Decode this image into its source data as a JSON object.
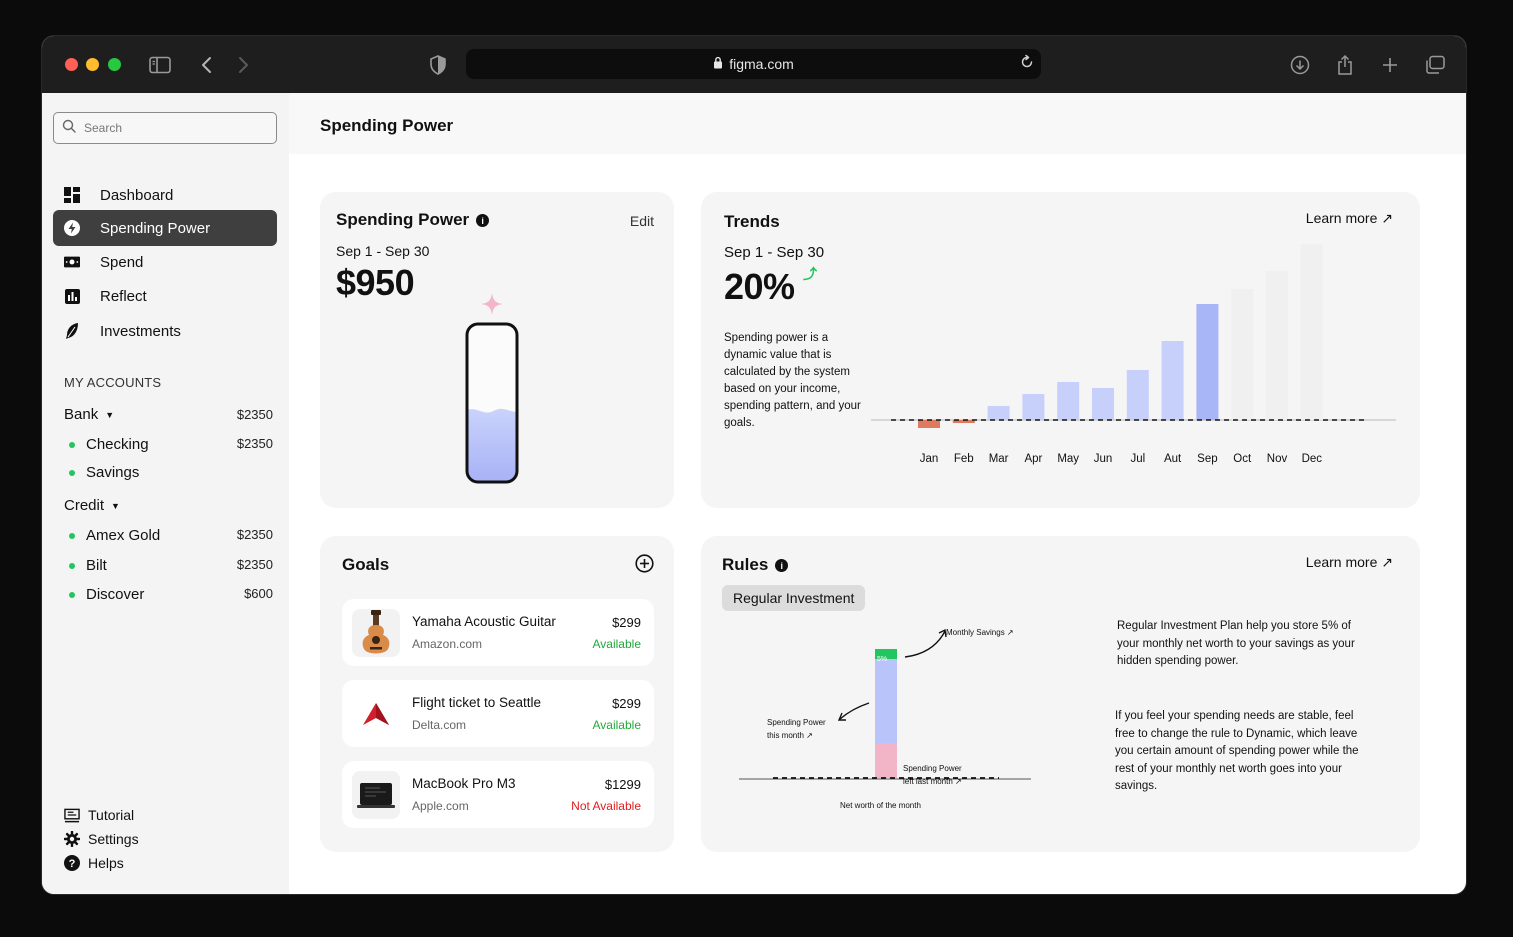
{
  "browser": {
    "url": "figma.com"
  },
  "sidebar": {
    "search_placeholder": "Search",
    "nav": [
      {
        "label": "Dashboard",
        "icon": "grid-icon"
      },
      {
        "label": "Spending Power",
        "icon": "bolt-icon",
        "active": true
      },
      {
        "label": "Spend",
        "icon": "cash-icon"
      },
      {
        "label": "Reflect",
        "icon": "bar-chart-icon"
      },
      {
        "label": "Investments",
        "icon": "feather-icon"
      }
    ],
    "accounts_heading": "MY ACCOUNTS",
    "bank": {
      "label": "Bank",
      "amount": "$2350",
      "accounts": [
        {
          "label": "Checking",
          "amount": "$2350"
        },
        {
          "label": "Savings",
          "amount": ""
        }
      ]
    },
    "credit": {
      "label": "Credit",
      "accounts": [
        {
          "label": "Amex Gold",
          "amount": "$2350"
        },
        {
          "label": "Bilt",
          "amount": "$2350"
        },
        {
          "label": "Discover",
          "amount": "$600"
        }
      ]
    },
    "footer": [
      {
        "label": "Tutorial"
      },
      {
        "label": "Settings"
      },
      {
        "label": "Helps"
      }
    ]
  },
  "header": {
    "title": "Spending Power"
  },
  "spending_power": {
    "title": "Spending Power",
    "edit_label": "Edit",
    "range": "Sep 1 - Sep 30",
    "amount": "$950",
    "fill_level": 0.45
  },
  "trends": {
    "title": "Trends",
    "learn_more": "Learn more",
    "range": "Sep 1 - Sep 30",
    "percent": "20%",
    "description": "Spending power is a dynamic value that is calculated by the system based on your income, spending pattern, and your goals."
  },
  "chart_data": {
    "type": "bar",
    "categories": [
      "Jan",
      "Feb",
      "Mar",
      "Apr",
      "May",
      "Jun",
      "Jul",
      "Aut",
      "Sep",
      "Oct",
      "Nov",
      "Dec"
    ],
    "values": [
      -8,
      -3,
      14,
      26,
      38,
      32,
      50,
      79,
      116,
      131,
      149,
      176
    ],
    "highlight": "Sep",
    "colors": {
      "negative": "#e07a5f",
      "past": "#c7d0fb",
      "current": "#a8b6f8",
      "future": "#f0f0f0"
    }
  },
  "goals": {
    "title": "Goals",
    "items": [
      {
        "name": "Yamaha Acoustic Guitar",
        "source": "Amazon.com",
        "price": "$299",
        "status": "Available",
        "available": true,
        "icon": "guitar-icon"
      },
      {
        "name": "Flight ticket to Seattle",
        "source": "Delta.com",
        "price": "$299",
        "status": "Available",
        "available": true,
        "icon": "delta-logo-icon"
      },
      {
        "name": "MacBook Pro M3",
        "source": "Apple.com",
        "price": "$1299",
        "status": "Not Available",
        "available": false,
        "icon": "laptop-icon"
      }
    ]
  },
  "rules": {
    "title": "Rules",
    "learn_more": "Learn more",
    "tag": "Regular Investment",
    "para1": "Regular Investment Plan help you store 5% of your monthly net worth to your savings as your hidden spending power.",
    "para2": "If you feel your spending needs are stable, feel free to change the rule to Dynamic, which leave you certain amount of spending power while the rest of your monthly net worth goes into your savings.",
    "diagram": {
      "monthly_savings": "Monthly Savings ↗",
      "sp_this_month_1": "Spending Power",
      "sp_this_month_2": "this month ↗",
      "sp_left_1": "Spending Power",
      "sp_left_2": "left last month ↗",
      "net_worth": "Net worth of the month",
      "pct": "5%"
    }
  }
}
